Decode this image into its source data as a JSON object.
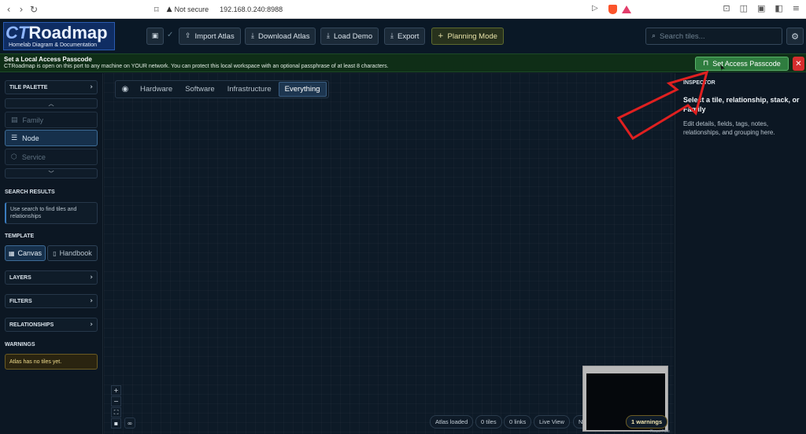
{
  "browser": {
    "security_label": "Not secure",
    "url": "192.168.0.240:8988"
  },
  "header": {
    "logo_title_prefix": "CT",
    "logo_title_rest": "Roadmap",
    "logo_subtitle": "Homelab Diagram & Documentation",
    "import_label": "Import Atlas",
    "download_label": "Download Atlas",
    "load_demo_label": "Load Demo",
    "export_label": "Export",
    "planning_label": "Planning Mode",
    "search_placeholder": "Search tiles..."
  },
  "banner": {
    "title": "Set a Local Access Passcode",
    "text": "CTRoadmap is open on this port to any machine on YOUR network. You can protect this local workspace with an optional passphrase of at least 8 characters.",
    "button_label": "Set Access Passcode"
  },
  "sidebar": {
    "tile_palette": "TILE PALETTE",
    "palette_items": [
      "Family",
      "Node",
      "Service"
    ],
    "search_results_label": "SEARCH RESULTS",
    "search_hint": "Use search to find tiles and relationships",
    "template_label": "TEMPLATE",
    "template_canvas": "Canvas",
    "template_handbook": "Handbook",
    "layers": "LAYERS",
    "filters": "FILTERS",
    "relationships": "RELATIONSHIPS",
    "warnings_label": "WARNINGS",
    "warnings_text": "Atlas has no tiles yet."
  },
  "canvas": {
    "tabs": [
      "Hardware",
      "Software",
      "Infrastructure",
      "Everything"
    ],
    "active_tab": "Everything",
    "status": [
      "Atlas loaded",
      "0 tiles",
      "0 links",
      "Live View",
      "No broken links",
      "1 warnings"
    ],
    "react_flow_label": "React Flow"
  },
  "inspector": {
    "label": "INSPECTOR",
    "title": "Select a tile, relationship, stack, or Family",
    "text": "Edit details, fields, tags, notes, relationships, and grouping here."
  },
  "colors": {
    "accent_green": "#2f7d3f",
    "close_red": "#d62e2e",
    "annotation_arrow": "#e02020"
  }
}
